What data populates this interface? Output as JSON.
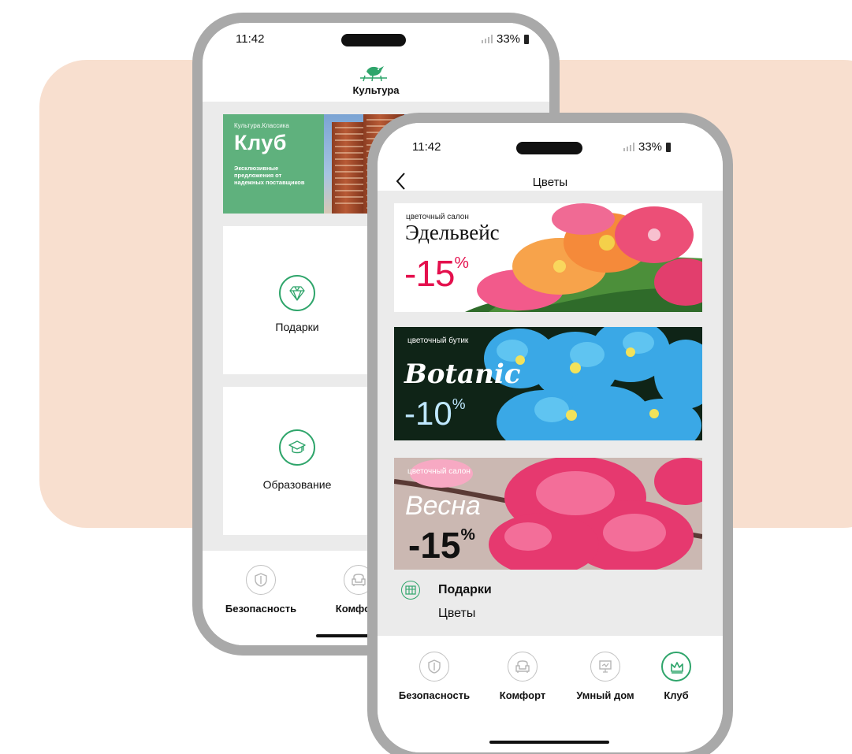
{
  "back_phone": {
    "status": {
      "time": "11:42",
      "battery": "33%"
    },
    "header_title": "Культура",
    "club_banner": {
      "kicker": "Культура.Классика",
      "title": "Клуб",
      "description": "Эксклюзивные предложения от надежных поставщиков"
    },
    "tiles": [
      {
        "label": "Подарки",
        "icon": "diamond-icon"
      },
      {
        "label": "Образование",
        "icon": "graduation-cap-icon"
      }
    ],
    "tabs": [
      {
        "label": "Безопасность",
        "icon": "shield-icon"
      },
      {
        "label": "Комфорт",
        "icon": "armchair-icon"
      }
    ]
  },
  "front_phone": {
    "status": {
      "time": "11:42",
      "battery": "33%"
    },
    "header_title": "Цветы",
    "promos": [
      {
        "subtitle": "цветочный салон",
        "name": "Эдельвейс",
        "discount": "-15",
        "percent": "%"
      },
      {
        "subtitle": "цветочный бутик",
        "name": "Botanic",
        "discount": "-10",
        "percent": "%"
      },
      {
        "subtitle": "цветочный салон",
        "name": "Весна",
        "discount": "-15",
        "percent": "%"
      }
    ],
    "category": {
      "title": "Подарки",
      "subtitle": "Цветы",
      "icon": "gift-icon"
    },
    "tabs": [
      {
        "label": "Безопасность",
        "icon": "shield-icon"
      },
      {
        "label": "Комфорт",
        "icon": "armchair-icon"
      },
      {
        "label": "Умный дом",
        "icon": "monitor-icon"
      },
      {
        "label": "Клуб",
        "icon": "crown-icon",
        "active": true
      }
    ]
  },
  "colors": {
    "accent_green": "#2fa56b",
    "club_green": "#5fb17d",
    "background_panel": "#f8dfcf",
    "discount_red": "#e4104d"
  }
}
